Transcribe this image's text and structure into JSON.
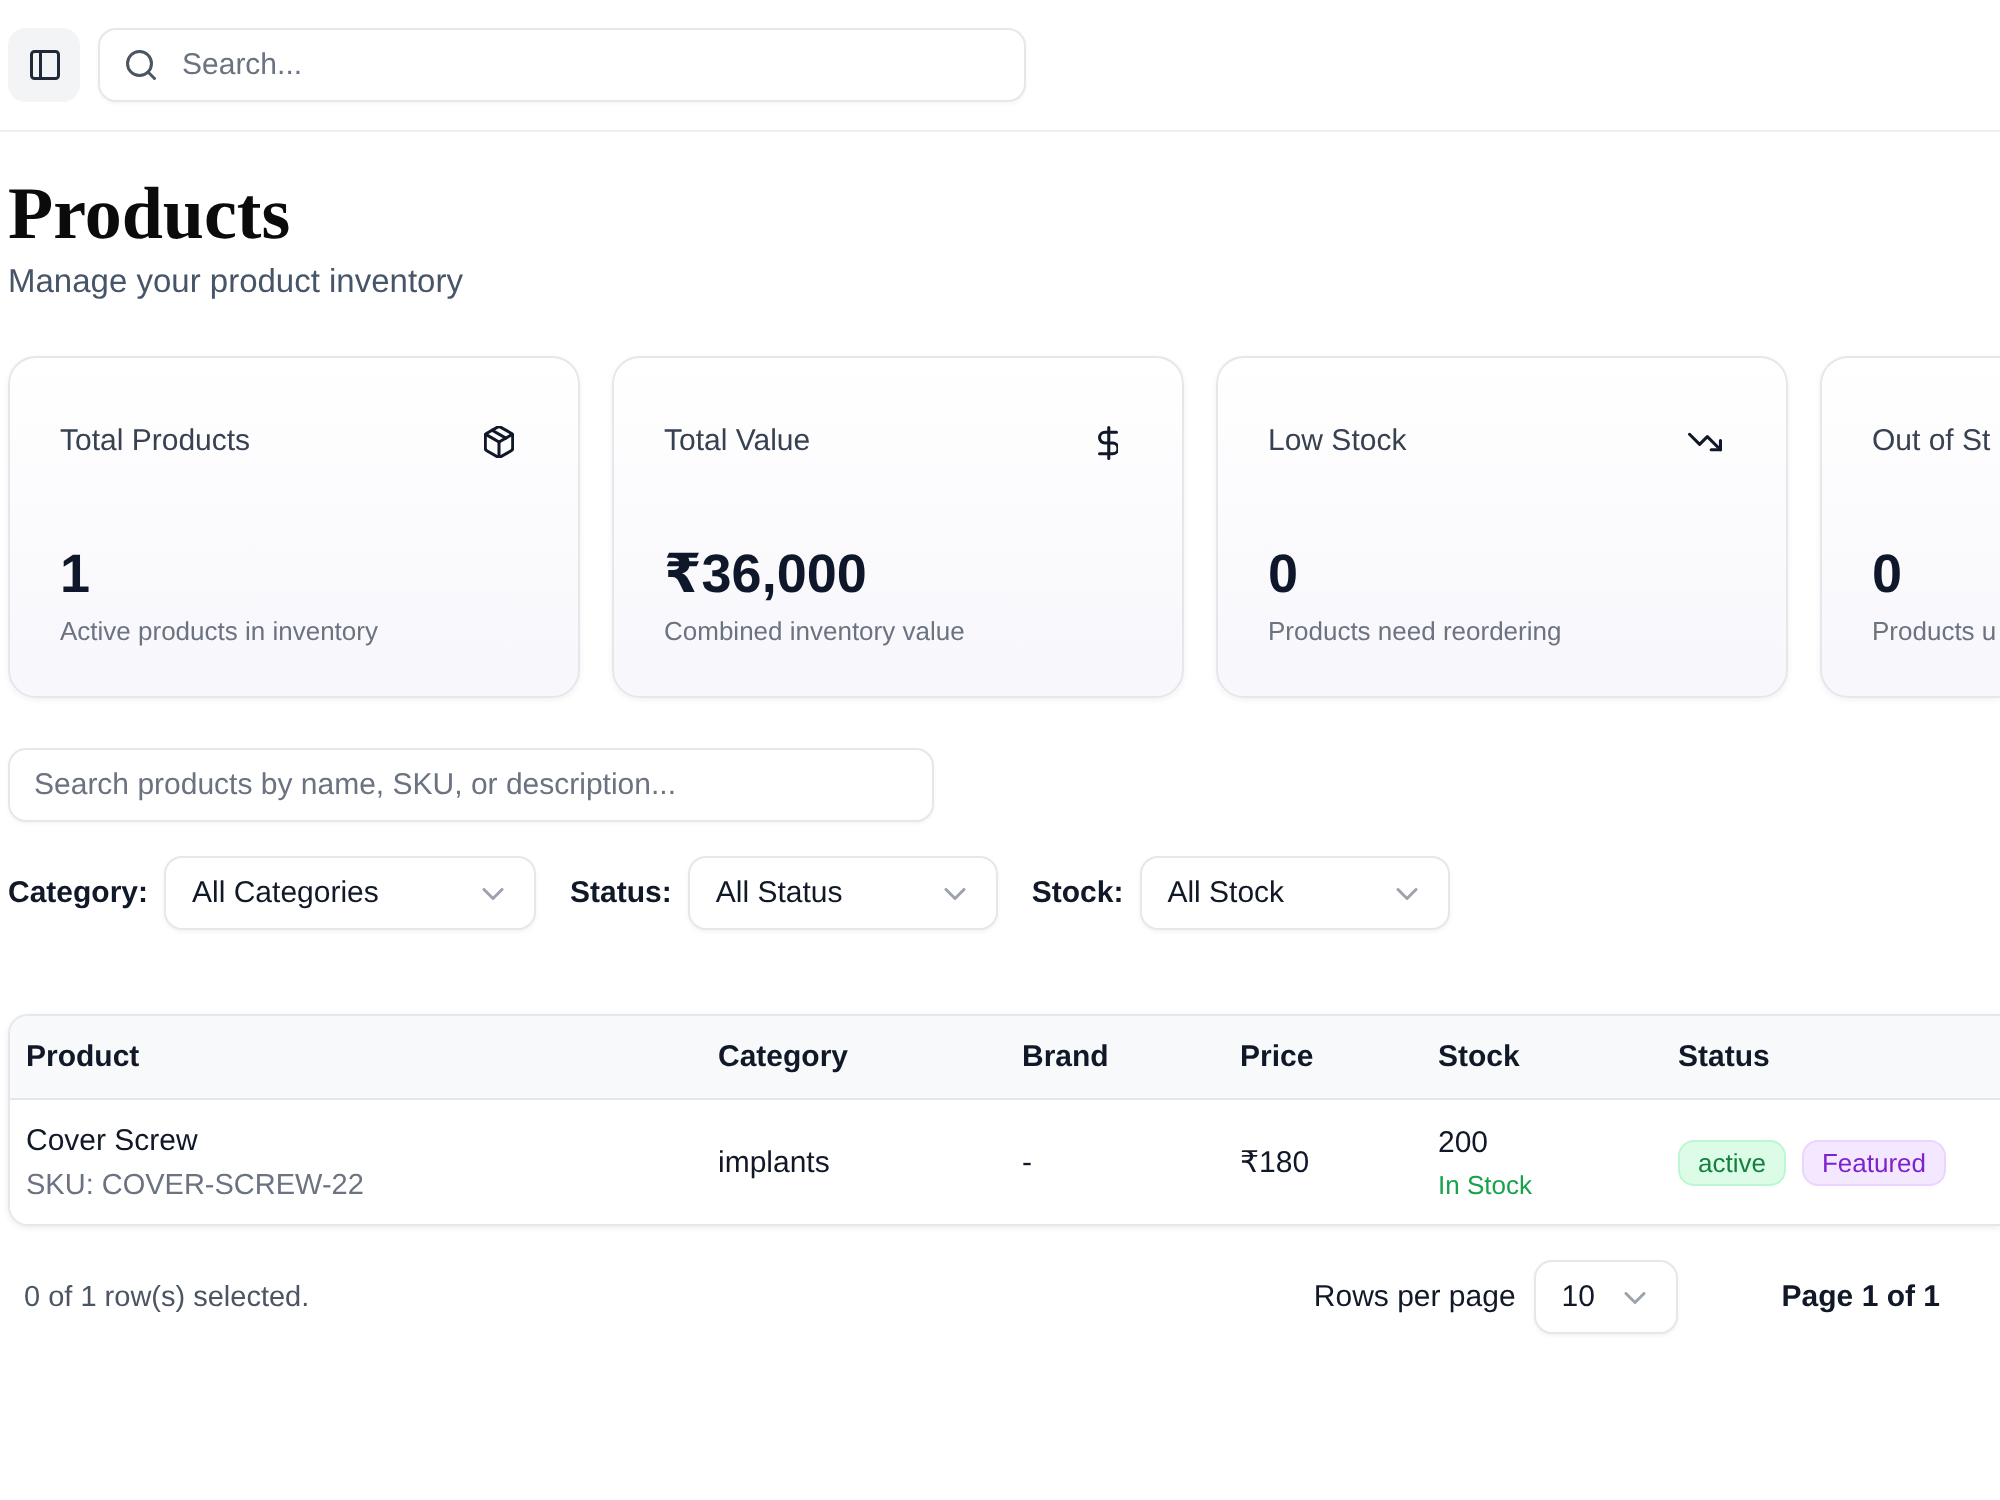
{
  "topbar": {
    "search": {
      "placeholder": "Search..."
    }
  },
  "page": {
    "title": "Products",
    "subtitle": "Manage your product inventory"
  },
  "stat_cards": [
    {
      "title": "Total Products",
      "value": "1",
      "description": "Active products in inventory"
    },
    {
      "title": "Total Value",
      "value": "₹36,000",
      "description": "Combined inventory value"
    },
    {
      "title": "Low Stock",
      "value": "0",
      "description": "Products need reordering"
    },
    {
      "title": "Out of St",
      "value": "0",
      "description": "Products u"
    }
  ],
  "product_search": {
    "placeholder": "Search products by name, SKU, or description..."
  },
  "filters": [
    {
      "label": "Category:",
      "value": "All Categories"
    },
    {
      "label": "Status:",
      "value": "All Status"
    },
    {
      "label": "Stock:",
      "value": "All Stock"
    }
  ],
  "table": {
    "columns": [
      "Product",
      "Category",
      "Brand",
      "Price",
      "Stock",
      "Status"
    ],
    "rows": [
      {
        "selected": false,
        "product": {
          "name": "Cover Screw",
          "sku": "SKU: COVER-SCREW-22"
        },
        "category": "implants",
        "brand": "-",
        "price": "₹180",
        "stock": {
          "quantity": "200",
          "label": "In Stock",
          "kind": "in_stock"
        },
        "badges": [
          {
            "text": "active",
            "kind": "status"
          },
          {
            "text": "Featured",
            "kind": "featured"
          }
        ]
      }
    ]
  },
  "footer": {
    "selection": "0 of 1 row(s) selected.",
    "rows_per_page": {
      "label": "Rows per page",
      "value": "10"
    },
    "page_info": "Page 1 of 1"
  }
}
